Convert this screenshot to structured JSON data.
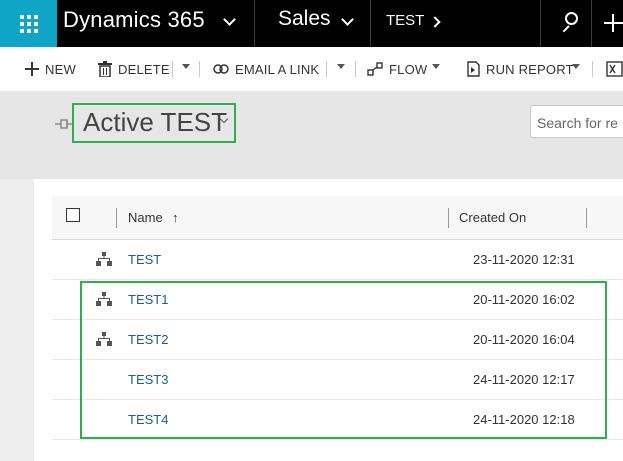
{
  "nav": {
    "app_name": "Dynamics 365",
    "area": "Sales",
    "entity": "TEST"
  },
  "commands": {
    "new": "NEW",
    "delete": "DELETE",
    "email_link": "EMAIL A LINK",
    "flow": "FLOW",
    "run_report": "RUN REPORT"
  },
  "view": {
    "title": "Active TEST",
    "search_placeholder": "Search for re"
  },
  "grid": {
    "columns": {
      "name": "Name",
      "created_on": "Created On"
    },
    "rows": [
      {
        "name": "TEST",
        "created_on": "23-11-2020 12:31",
        "hierarchy": true
      },
      {
        "name": "TEST1",
        "created_on": "20-11-2020 16:02",
        "hierarchy": true
      },
      {
        "name": "TEST2",
        "created_on": "20-11-2020 16:04",
        "hierarchy": true
      },
      {
        "name": "TEST3",
        "created_on": "24-11-2020 12:17",
        "hierarchy": false
      },
      {
        "name": "TEST4",
        "created_on": "24-11-2020 12:18",
        "hierarchy": false
      }
    ]
  },
  "colors": {
    "nav_bg": "#000000",
    "waffle_bg": "#0ea5c6",
    "highlight": "#2bb04a",
    "link": "#1a5a9c"
  }
}
